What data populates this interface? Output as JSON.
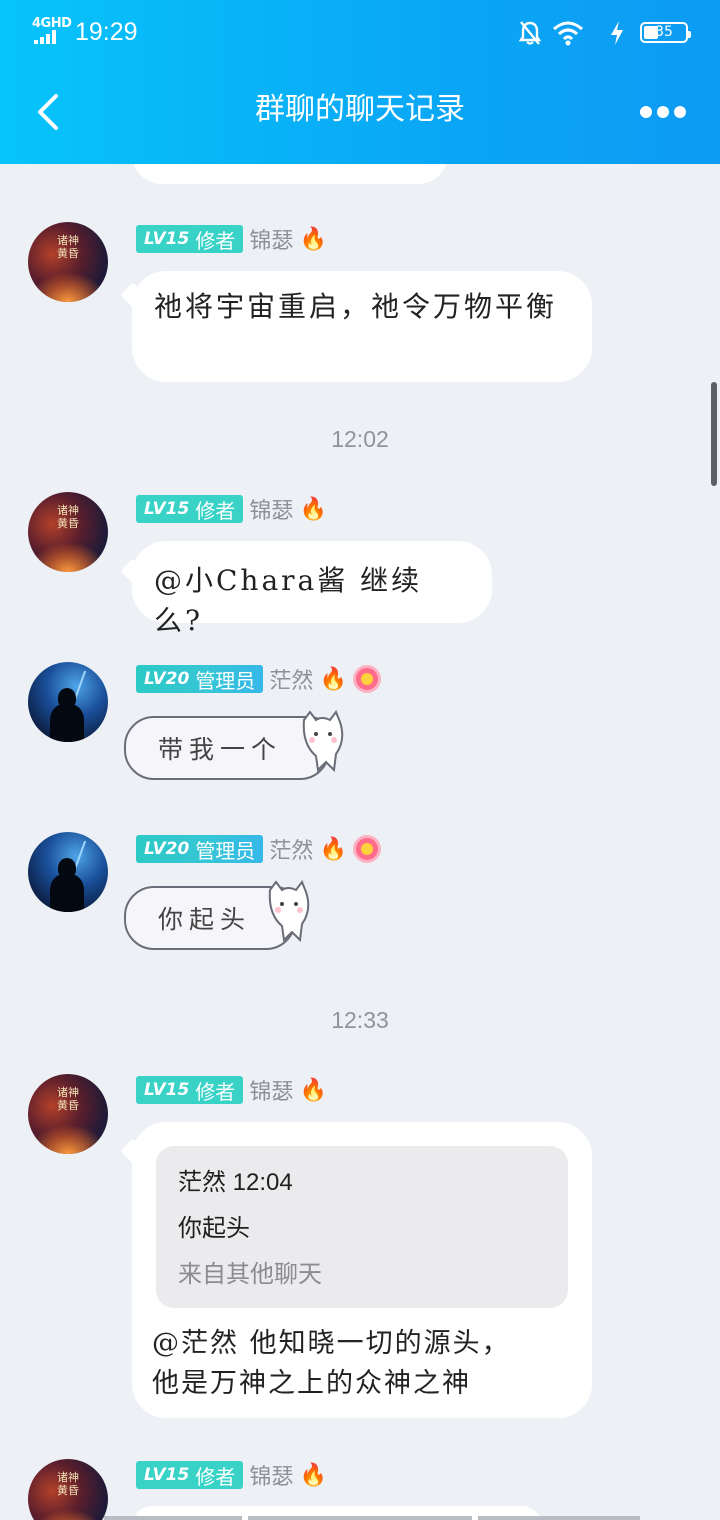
{
  "status_bar": {
    "network": "4GHD",
    "time": "19:29",
    "battery": "35",
    "icons": [
      "mute-bell-icon",
      "wifi-icon",
      "charging-icon",
      "battery-icon"
    ]
  },
  "header": {
    "title": "群聊的聊天记录",
    "back_icon": "back-chevron-icon",
    "more_icon": "more-dots-icon"
  },
  "colors": {
    "header_gradient_start": "#07c4fb",
    "header_gradient_end": "#0d9bf3",
    "lv15_badge": "#39d2c7",
    "background": "#edf0f5"
  },
  "messages": [
    {
      "sender": "锦瑟",
      "level": "LV15",
      "title": "修者",
      "badges": [
        "fire-icon"
      ],
      "text": "祂将宇宙重启，祂令万物平衡"
    },
    {
      "time_divider": "12:02"
    },
    {
      "sender": "锦瑟",
      "level": "LV15",
      "title": "修者",
      "badges": [
        "fire-icon"
      ],
      "text": "@小Chara酱 继续么?"
    },
    {
      "sender": "茫然",
      "level": "LV20",
      "title": "管理员",
      "badges": [
        "fire-icon",
        "smile-face-icon"
      ],
      "text": "带我一个"
    },
    {
      "sender": "茫然",
      "level": "LV20",
      "title": "管理员",
      "badges": [
        "fire-icon",
        "smile-face-icon"
      ],
      "text": "你起头"
    },
    {
      "time_divider": "12:33"
    },
    {
      "sender": "锦瑟",
      "level": "LV15",
      "title": "修者",
      "badges": [
        "fire-icon"
      ],
      "quote": {
        "header": "茫然 12:04",
        "text": "你起头",
        "source": "来自其他聊天"
      },
      "text_line1": "@茫然 他知晓一切的源头，",
      "text_line2": "他是万神之上的众神之神"
    },
    {
      "sender": "锦瑟",
      "level": "LV15",
      "title": "修者",
      "badges": [
        "fire-icon"
      ]
    }
  ],
  "avatar_text": "诸神黄昏"
}
